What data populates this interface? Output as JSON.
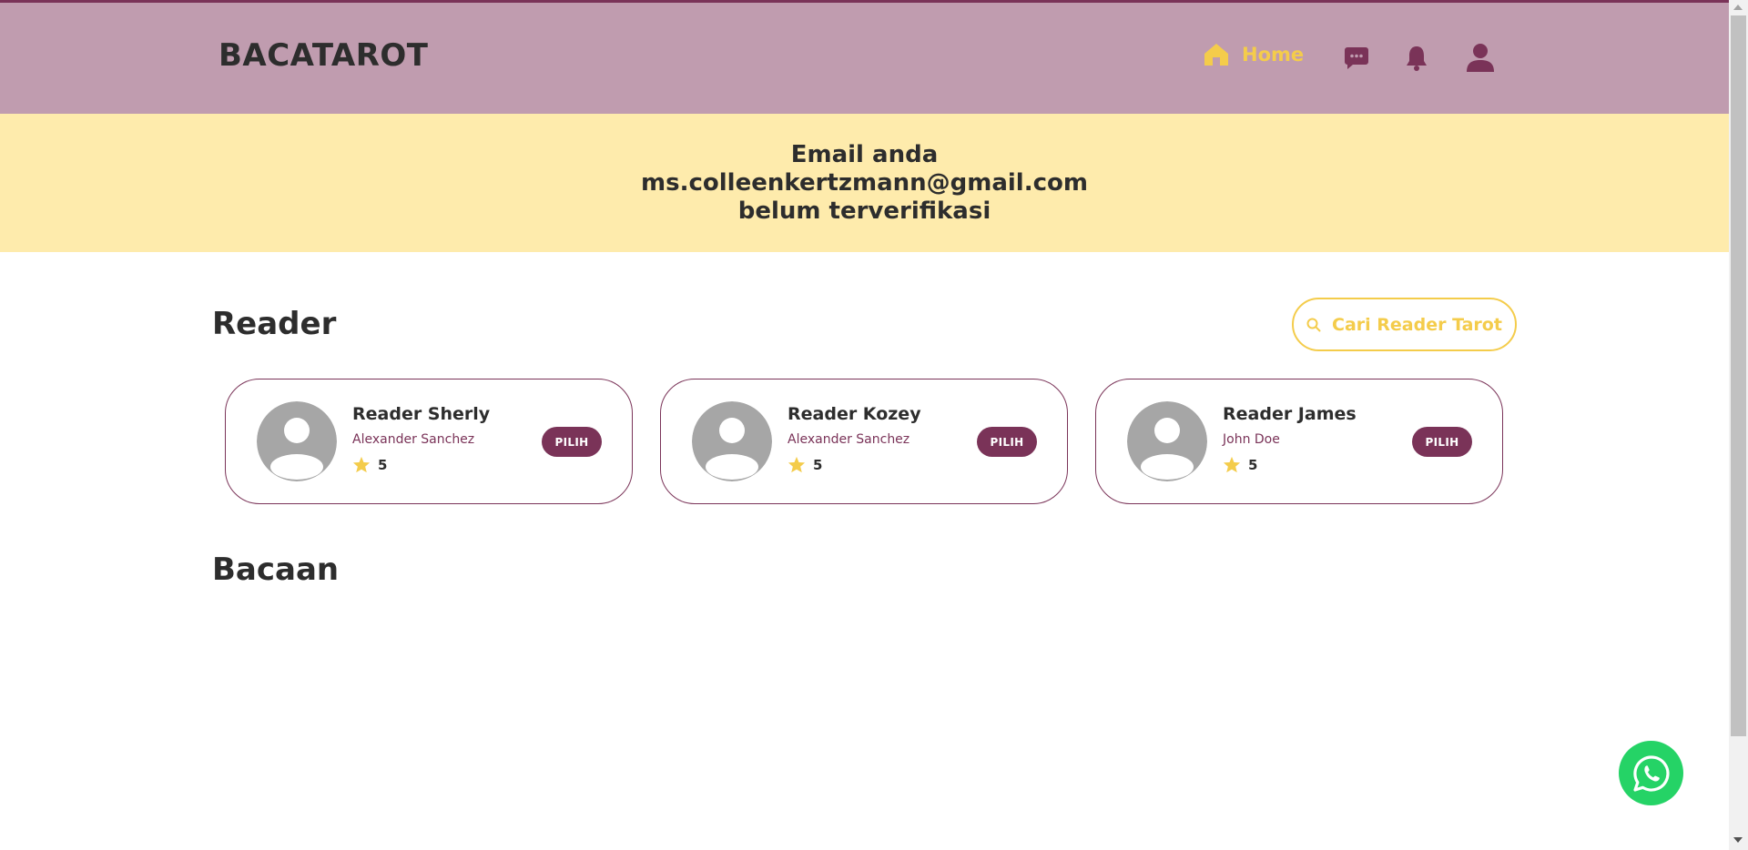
{
  "header": {
    "brand": "BACATAROT",
    "nav": {
      "home_label": "Home",
      "home_icon": "home-icon",
      "chat_icon": "chat-icon",
      "notification_icon": "bell-icon",
      "profile_icon": "user-icon"
    }
  },
  "verify_banner": {
    "line1": "Email anda",
    "line2": "ms.colleenkertzmann@gmail.com",
    "line3": "belum terverifikasi"
  },
  "reader_section": {
    "title": "Reader",
    "search_label": "Cari Reader Tarot",
    "search_icon": "search-icon",
    "readers": [
      {
        "name": "Reader Sherly",
        "sub": "Alexander Sanchez",
        "rating": "5",
        "button": "PILIH"
      },
      {
        "name": "Reader Kozey",
        "sub": "Alexander Sanchez",
        "rating": "5",
        "button": "PILIH"
      },
      {
        "name": "Reader James",
        "sub": "John Doe",
        "rating": "5",
        "button": "PILIH"
      }
    ]
  },
  "bacaan_section": {
    "title": "Bacaan"
  },
  "floating": {
    "whatsapp_icon": "whatsapp-icon"
  },
  "colors": {
    "navbar": "#c09caf",
    "accent_plum": "#7a3358",
    "accent_yellow": "#f4cc4b",
    "banner": "#feebac",
    "whatsapp": "#25d366"
  }
}
